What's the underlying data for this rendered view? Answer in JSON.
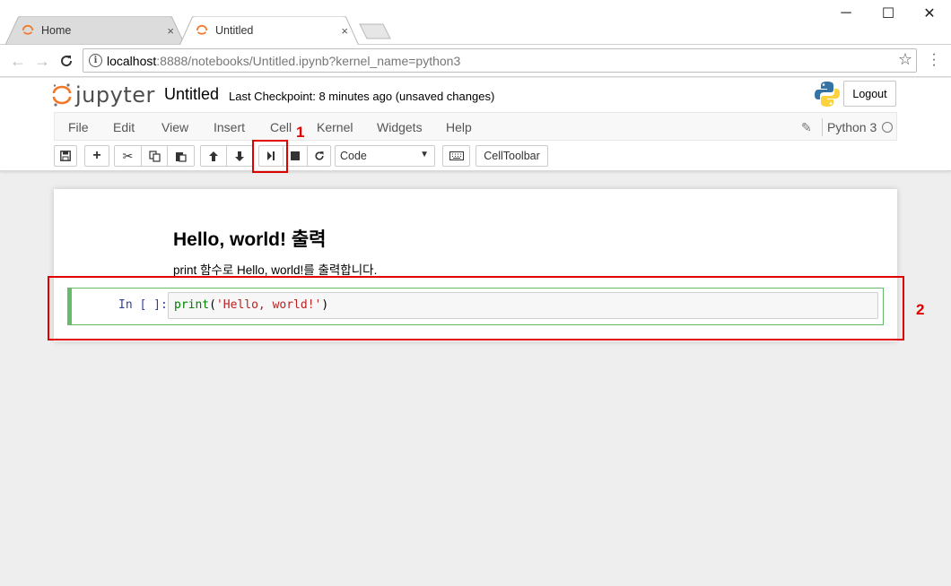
{
  "browser": {
    "tabs": [
      {
        "label": "Home"
      },
      {
        "label": "Untitled"
      }
    ],
    "tab_close_glyph": "×",
    "address": {
      "host": "localhost",
      "path": ":8888/notebooks/Untitled.ipynb?kernel_name=python3"
    },
    "window_controls": {
      "minimize": "─",
      "maximize": "☐",
      "close": "✕"
    }
  },
  "jupyter": {
    "logo_text": "jupyter",
    "notebook_name": "Untitled",
    "checkpoint": "Last Checkpoint: 8 minutes ago (unsaved changes)",
    "logout_label": "Logout",
    "menu": [
      "File",
      "Edit",
      "View",
      "Insert",
      "Cell",
      "Kernel",
      "Widgets",
      "Help"
    ],
    "kernel_name": "Python 3",
    "toolbar": {
      "cell_type_selected": "Code",
      "celltoolbar_label": "CellToolbar"
    }
  },
  "notebook": {
    "markdown_heading": "Hello, world! 출력",
    "markdown_text": "print 함수로 Hello, world!를 출력합니다.",
    "code_cell": {
      "prompt": "In [ ]:",
      "code_func": "print",
      "code_open": "(",
      "code_string": "'Hello, world!'",
      "code_close": ")"
    }
  },
  "annotations": [
    {
      "number": "1",
      "color": "#e00000"
    },
    {
      "number": "2",
      "color": "#e00000"
    }
  ],
  "colors": {
    "jupyter_orange": "#f37726",
    "cell_border_active": "#66bb6a",
    "prompt_blue": "#303f9f",
    "annotation_red": "#e00000"
  }
}
